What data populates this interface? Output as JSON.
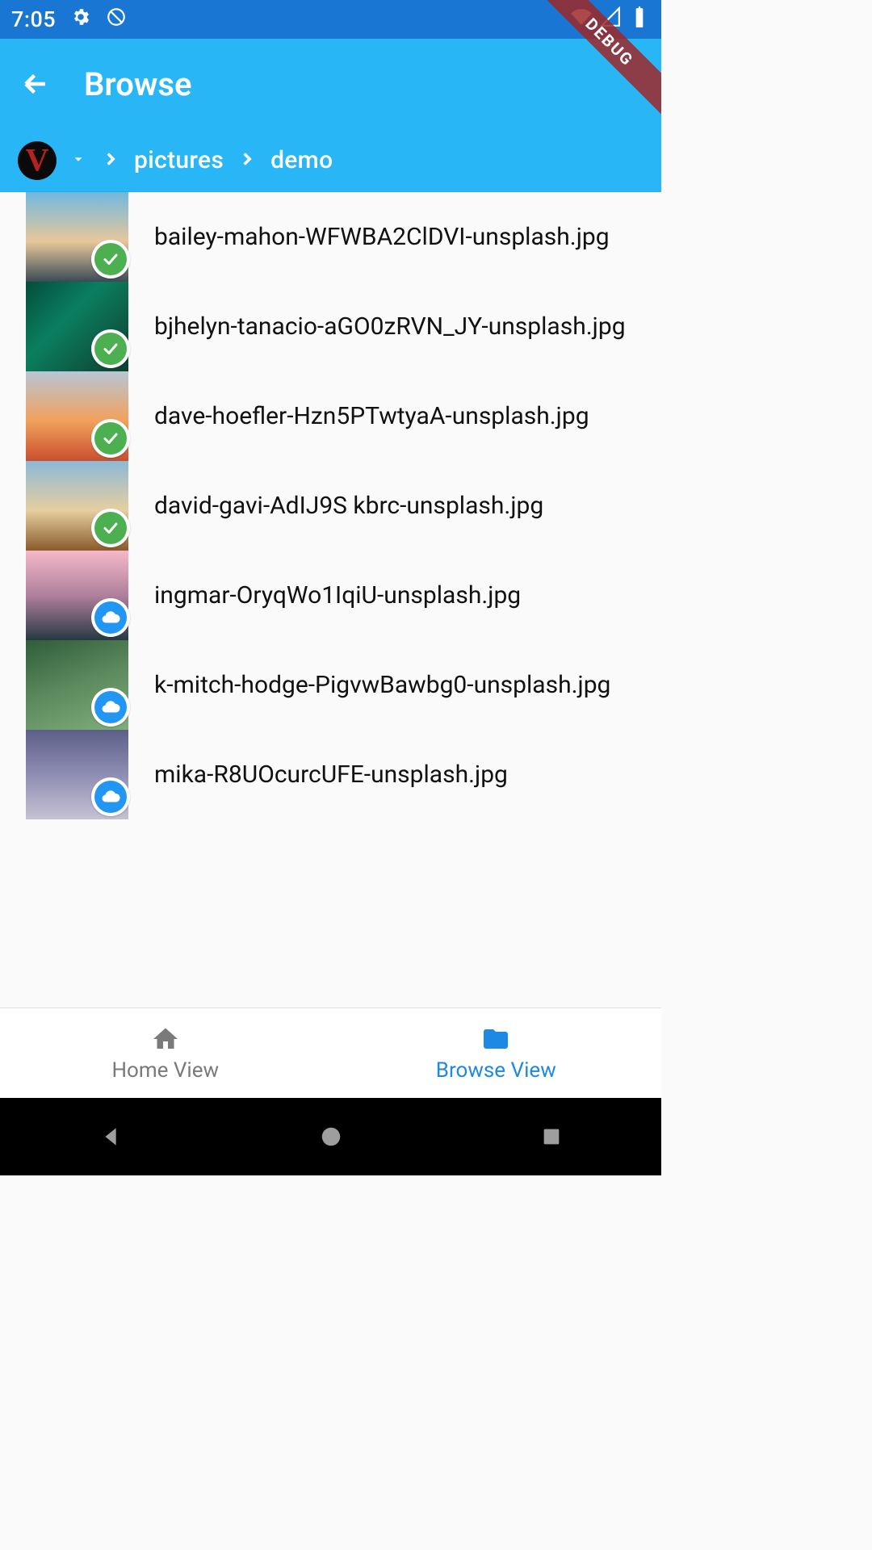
{
  "status": {
    "time": "7:05"
  },
  "appbar": {
    "title": "Browse"
  },
  "breadcrumb": {
    "segments": [
      "pictures",
      "demo"
    ]
  },
  "files": [
    {
      "name": "bailey-mahon-WFWBA2ClDVI-unsplash.jpg",
      "status": "synced",
      "thumb_class": "tg0"
    },
    {
      "name": "bjhelyn-tanacio-aGO0zRVN_JY-unsplash.jpg",
      "status": "synced",
      "thumb_class": "tg1"
    },
    {
      "name": "dave-hoefler-Hzn5PTwtyaA-unsplash.jpg",
      "status": "synced",
      "thumb_class": "tg2"
    },
    {
      "name": "david-gavi-AdIJ9S kbrc-unsplash.jpg",
      "status": "synced",
      "thumb_class": "tg3"
    },
    {
      "name": "ingmar-OryqWo1IqiU-unsplash.jpg",
      "status": "cloud",
      "thumb_class": "tg4"
    },
    {
      "name": "k-mitch-hodge-PigvwBawbg0-unsplash.jpg",
      "status": "cloud",
      "thumb_class": "tg5"
    },
    {
      "name": "mika-R8UOcurcUFE-unsplash.jpg",
      "status": "cloud",
      "thumb_class": "tg6"
    }
  ],
  "bottom_nav": {
    "home_label": "Home View",
    "browse_label": "Browse View",
    "active": "browse"
  },
  "debug_label": "DEBUG"
}
